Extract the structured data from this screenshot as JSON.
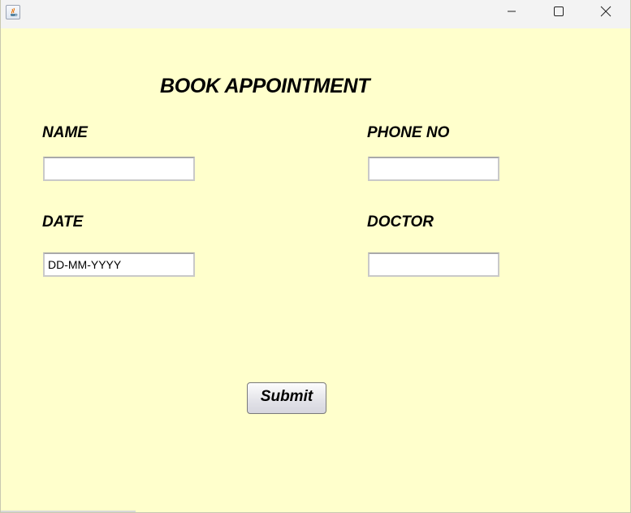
{
  "window": {
    "app_icon": "java-icon",
    "controls": {
      "minimize_icon": "minimize-icon",
      "maximize_icon": "maximize-icon",
      "close_icon": "close-icon"
    }
  },
  "form": {
    "title": "BOOK APPOINTMENT",
    "name_label": "NAME",
    "name_value": "",
    "phone_label": "PHONE NO",
    "phone_value": "",
    "date_label": "DATE",
    "date_value": "DD-MM-YYYY",
    "doctor_label": "DOCTOR",
    "doctor_value": "",
    "submit_label": "Submit"
  },
  "colors": {
    "background": "#ffffcc",
    "titlebar": "#f3f3f3"
  }
}
